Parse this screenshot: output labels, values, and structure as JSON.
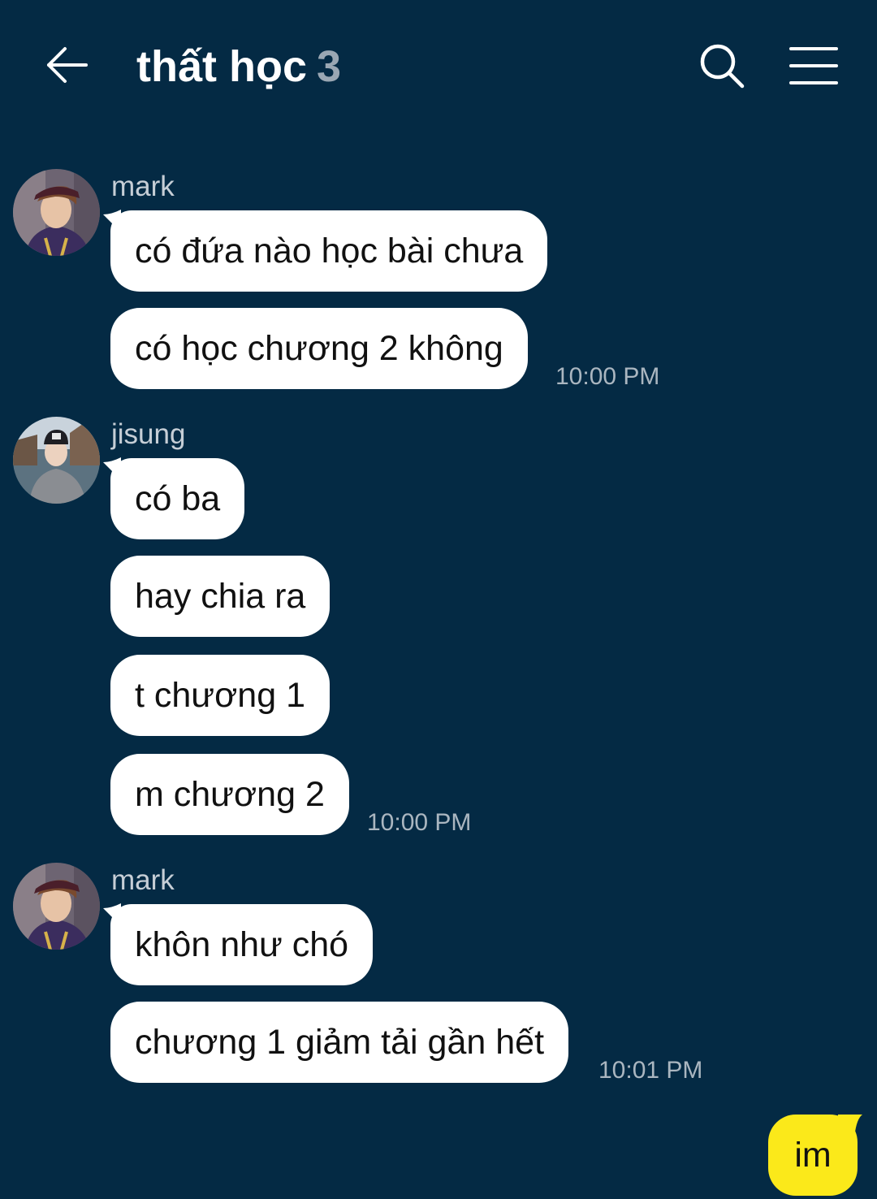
{
  "header": {
    "title": "thất học",
    "member_count": "3",
    "back_icon": "arrow-left-icon",
    "search_icon": "search-icon",
    "menu_icon": "menu-icon"
  },
  "messages": [
    {
      "sender": "mark",
      "bubbles": [
        "có đứa nào học bài chưa",
        "có học chương 2 không"
      ],
      "time": "10:00 PM"
    },
    {
      "sender": "jisung",
      "bubbles": [
        "có ba",
        "hay chia ra",
        "t chương 1",
        "m chương 2"
      ],
      "time": "10:00 PM"
    },
    {
      "sender": "mark",
      "bubbles": [
        "khôn như chó",
        "chương 1 giảm tải gần hết"
      ],
      "time": "10:01 PM"
    }
  ],
  "my_message": {
    "text": "im"
  },
  "colors": {
    "background": "#042a44",
    "incoming_bubble": "#ffffff",
    "outgoing_bubble": "#fbe91a",
    "timestamp": "#aab6c0",
    "sender_name": "#c6ced6"
  }
}
